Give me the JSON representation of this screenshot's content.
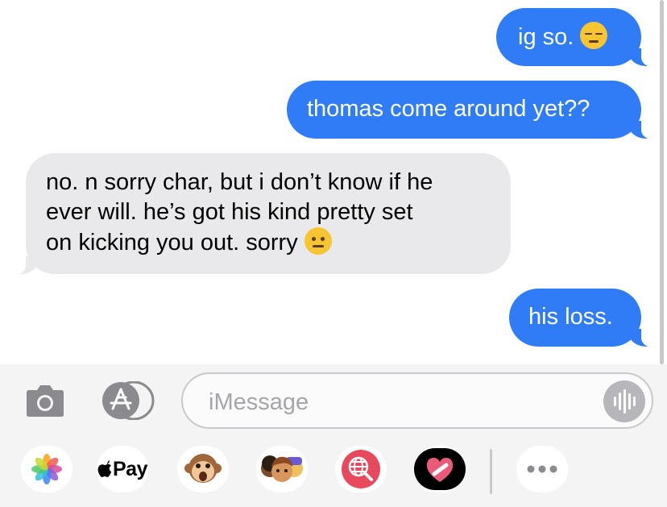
{
  "messages": [
    {
      "from": "me",
      "text": "ig so.",
      "emoji": "pensive-face-emoji"
    },
    {
      "from": "me",
      "text": "thomas come around yet??"
    },
    {
      "from": "them",
      "lines": [
        "no. n sorry char, but i don’t know if he",
        "ever will. he’s got his kind pretty set",
        "on kicking you out. sorry"
      ],
      "emoji": "neutral-face-emoji"
    },
    {
      "from": "me",
      "text": "his loss."
    }
  ],
  "composer": {
    "placeholder": "iMessage",
    "camera_icon": "camera-icon",
    "apps_icon": "app-store-icon",
    "audio_icon": "audio-waveform-icon"
  },
  "app_tray": {
    "items": [
      {
        "name": "photos",
        "icon": "photos-icon"
      },
      {
        "name": "apple-pay",
        "label": "Pay",
        "icon": "apple-logo-icon"
      },
      {
        "name": "animoji",
        "icon": "monkey-animoji-icon"
      },
      {
        "name": "memoji",
        "icon": "memoji-stickers-icon"
      },
      {
        "name": "web-search",
        "icon": "globe-search-icon"
      },
      {
        "name": "digital-touch",
        "icon": "heart-touch-icon"
      },
      {
        "name": "more",
        "icon": "more-dots-icon"
      }
    ]
  },
  "colors": {
    "sent_bubble": "#2f7cf6",
    "received_bubble": "#e9e9eb",
    "tray_bg": "#f4f4f5"
  }
}
